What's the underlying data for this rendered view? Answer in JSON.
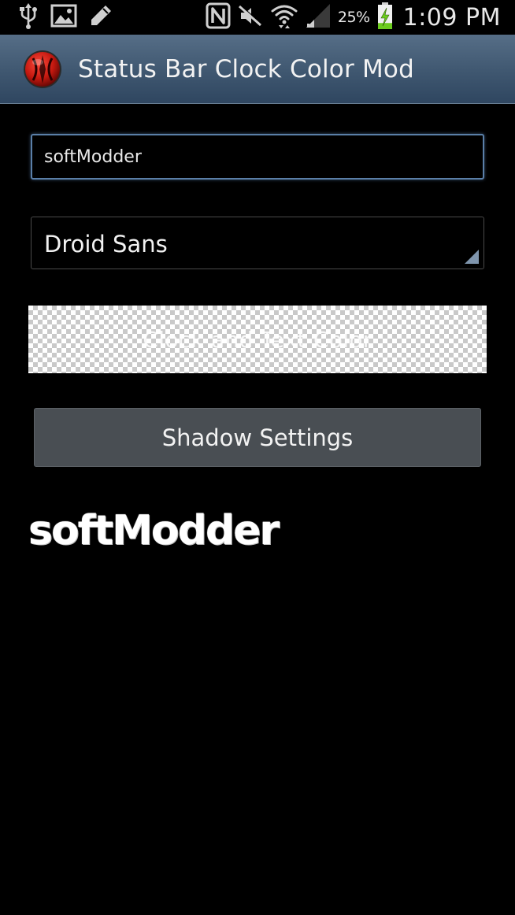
{
  "status_bar": {
    "left_icons": [
      "usb-icon",
      "image-icon",
      "pencil-icon"
    ],
    "right_icons": [
      "nfc-icon",
      "mute-icon",
      "wifi-icon",
      "signal-icon",
      "battery-charging-icon"
    ],
    "battery_percent": "25%",
    "battery_level": 0.25,
    "time": "1:09 PM"
  },
  "action_bar": {
    "title": "Status Bar Clock Color Mod",
    "icon": "app-logo-icon"
  },
  "form": {
    "text_input_value": "softModder",
    "font_spinner_value": "Droid Sans",
    "color_button_label": "Clock and Text Color",
    "shadow_button_label": "Shadow Settings"
  },
  "preview": {
    "text": "softModder"
  },
  "colors": {
    "action_bar_top": "#566e87",
    "action_bar_bottom": "#2f4660",
    "input_border": "#5a7fa8",
    "button_bg": "#494e53",
    "battery_green": "#6ccc1e"
  }
}
